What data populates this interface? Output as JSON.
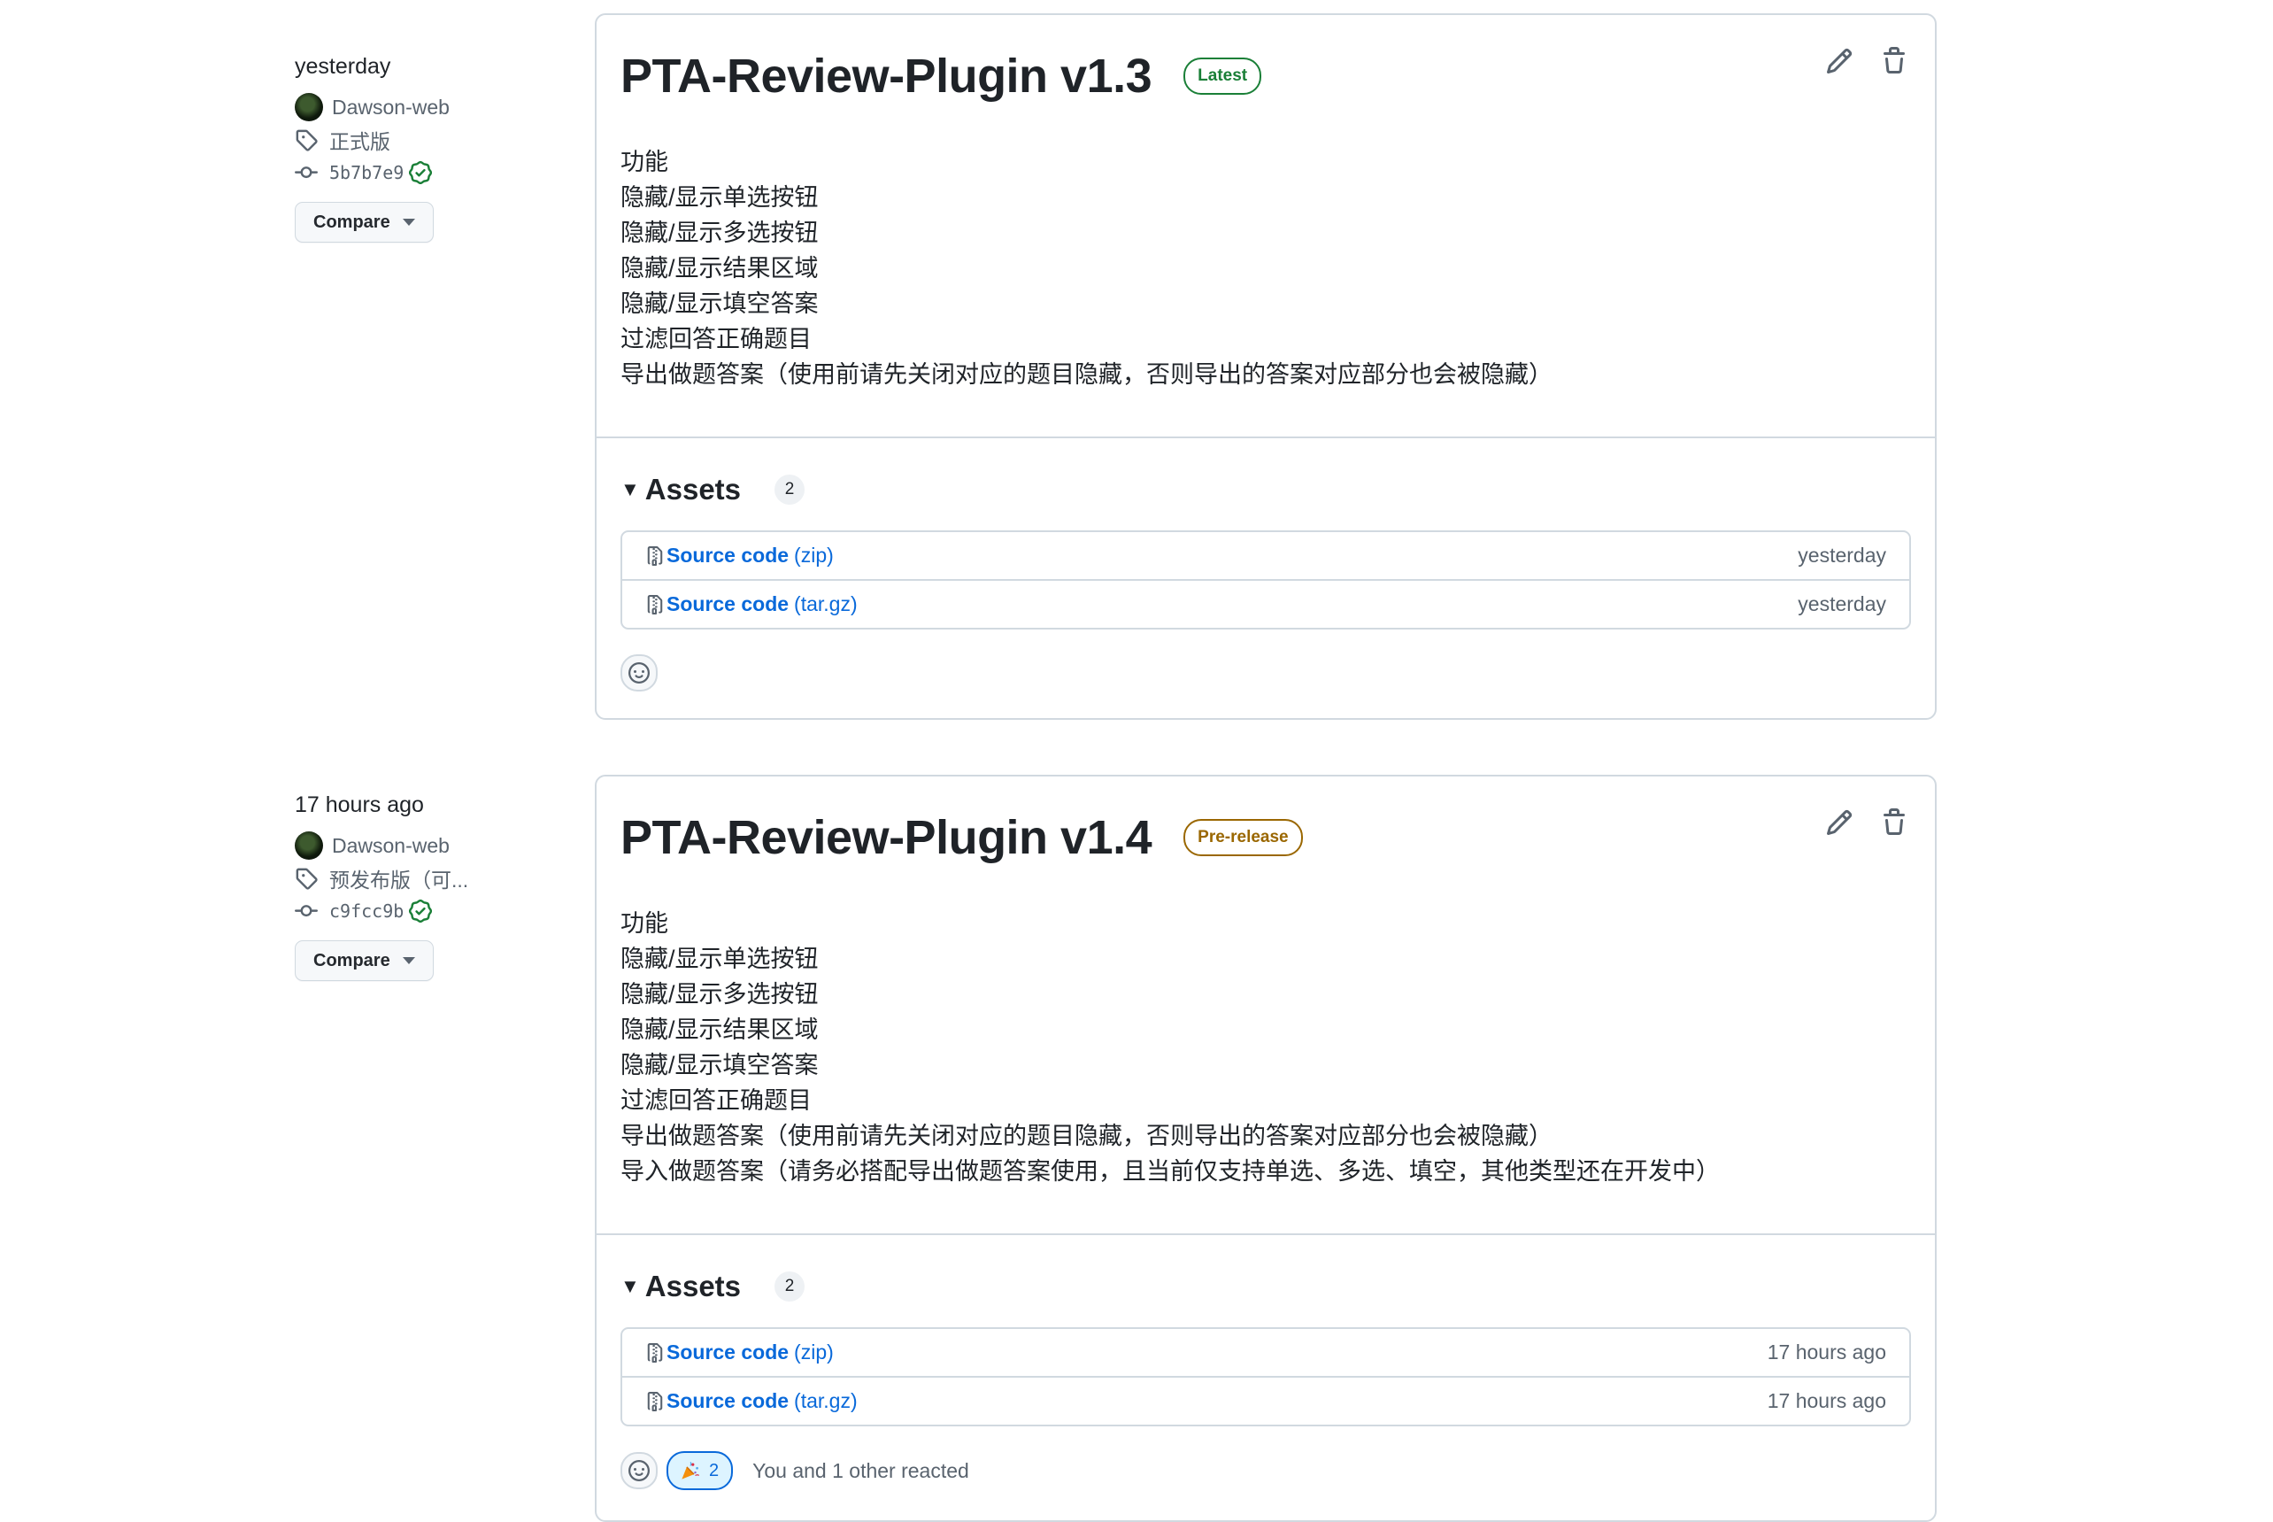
{
  "releases": [
    {
      "date": "yesterday",
      "author": "Dawson-web",
      "tag": "正式版",
      "commit": "5b7b7e9",
      "compare_label": "Compare",
      "title": "PTA-Review-Plugin v1.3",
      "badge": "Latest",
      "notes": [
        "功能",
        "隐藏/显示单选按钮",
        "隐藏/显示多选按钮",
        "隐藏/显示结果区域",
        "隐藏/显示填空答案",
        "过滤回答正确题目",
        "导出做题答案（使用前请先关闭对应的题目隐藏，否则导出的答案对应部分也会被隐藏）"
      ],
      "assets_label": "Assets",
      "assets_count": "2",
      "assets": [
        {
          "name": "Source code",
          "ext": "(zip)",
          "date": "yesterday"
        },
        {
          "name": "Source code",
          "ext": "(tar.gz)",
          "date": "yesterday"
        }
      ]
    },
    {
      "date": "17 hours ago",
      "author": "Dawson-web",
      "tag": "预发布版（可...",
      "commit": "c9fcc9b",
      "compare_label": "Compare",
      "title": "PTA-Review-Plugin v1.4",
      "badge": "Pre-release",
      "notes": [
        "功能",
        "隐藏/显示单选按钮",
        "隐藏/显示多选按钮",
        "隐藏/显示结果区域",
        "隐藏/显示填空答案",
        "过滤回答正确题目",
        "导出做题答案（使用前请先关闭对应的题目隐藏，否则导出的答案对应部分也会被隐藏）",
        "导入做题答案（请务必搭配导出做题答案使用，且当前仅支持单选、多选、填空，其他类型还在开发中）"
      ],
      "assets_label": "Assets",
      "assets_count": "2",
      "assets": [
        {
          "name": "Source code",
          "ext": "(zip)",
          "date": "17 hours ago"
        },
        {
          "name": "Source code",
          "ext": "(tar.gz)",
          "date": "17 hours ago"
        }
      ],
      "reaction": {
        "emoji": "tada-icon",
        "count": "2",
        "text": "You and 1 other reacted"
      }
    }
  ],
  "colors": {
    "link": "#0969da",
    "latest": "#1a7f37",
    "prerelease": "#9a6700",
    "muted": "#59636e",
    "border": "#d1d9e0"
  }
}
